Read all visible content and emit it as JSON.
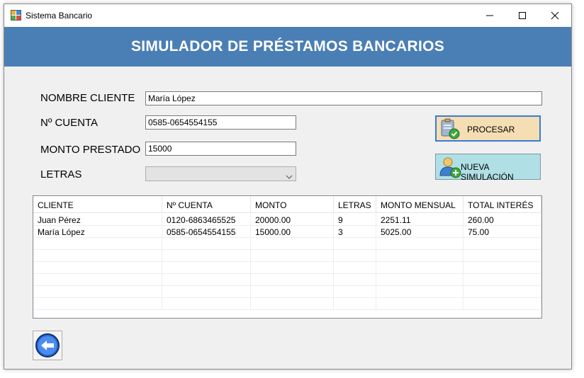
{
  "window": {
    "title": "Sistema Bancario",
    "icon": "app-window-icon"
  },
  "banner": {
    "title": "SIMULADOR DE PRÉSTAMOS BANCARIOS",
    "color": "#4a7fb5"
  },
  "form": {
    "nombre_label": "NOMBRE CLIENTE",
    "nombre_value": "María López",
    "cuenta_label": "Nº CUENTA",
    "cuenta_value": "0585-0654554155",
    "monto_label": "MONTO PRESTADO",
    "monto_value": "15000",
    "letras_label": "LETRAS",
    "letras_value": ""
  },
  "buttons": {
    "procesar_label": "PROCESAR",
    "procesar_color": "#f5deb3",
    "nueva_label": "NUEVA SIMULACIÓN",
    "nueva_color": "#b0e0e6"
  },
  "table": {
    "columns": [
      "CLIENTE",
      "Nº CUENTA",
      "MONTO",
      "LETRAS",
      "MONTO MENSUAL",
      "TOTAL INTERÉS"
    ],
    "rows": [
      [
        "Juan Pérez",
        "0120-6863465525",
        "20000.00",
        "9",
        "2251.11",
        "260.00"
      ],
      [
        "María López",
        "0585-0654554155",
        "15000.00",
        "3",
        "5025.00",
        "75.00"
      ]
    ]
  }
}
